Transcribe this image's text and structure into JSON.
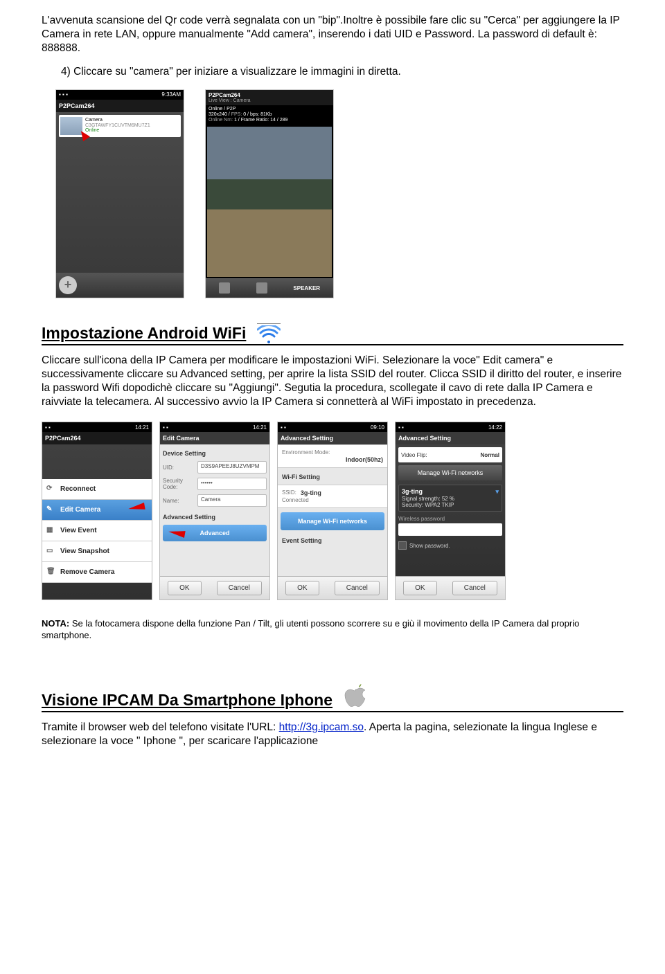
{
  "para1": "L'avvenuta scansione del Qr code verrà segnalata con un \"bip\".Inoltre è possibile fare clic su \"Cerca\" per aggiungere la IP Camera in rete LAN, oppure manualmente \"Add camera\", inserendo i dati UID e Password. La password di default è: 888888.",
  "step4": "4)  Cliccare su \"camera\" per iniziare a visualizzare le immagini in diretta.",
  "shot1": {
    "status_time": "9:33AM",
    "appname": "P2PCam264",
    "cam_name": "Camera",
    "cam_uid": "C3GTAWFY1CUVTM6MU7Z1",
    "cam_status": "Online"
  },
  "shot2": {
    "appname": "P2PCam264",
    "subtitle": "Live View : Camera",
    "line1": "Online / P2P",
    "line2_a": "320x240 / ",
    "line2_b": "FPS:",
    "line2_c": "0 / bps:",
    "line2_d": "81Kb",
    "line3_a": "Online Nm:",
    "line3_b": "1 / Frame Ratio:",
    "line3_c": "14 / 289",
    "speaker": "SPEAKER"
  },
  "heading_wifi": "Impostazione Android WiFi",
  "para_wifi": "Cliccare sull'icona della IP Camera per modificare le impostazioni WiFi. Selezionare la voce\" Edit camera\" e successivamente cliccare su Advanced setting, per aprire la lista SSID del router. Clicca SSID il diritto del router, e inserire la password Wifi dopodichè cliccare su \"Aggiungi\". Segutia la procedura, scollegate il cavo di rete dalla IP Camera e raivviate la telecamera. Al successivo avvio la IP Camera si connetterà al WiFi impostato in precedenza.",
  "shotA": {
    "time": "14:21",
    "appname": "P2PCam264",
    "items": [
      "Reconnect",
      "Edit Camera",
      "View Event",
      "View Snapshot",
      "Remove Camera"
    ]
  },
  "shotB": {
    "time": "14:21",
    "title": "Edit Camera",
    "section": "Device Setting",
    "uid_label": "UID:",
    "uid_val": "D3S9APEEJ8UZVMPM",
    "sec_label": "Security Code:",
    "sec_val": "••••••",
    "name_label": "Name:",
    "name_val": "Camera",
    "adv_label": "Advanced Setting",
    "adv_btn": "Advanced",
    "ok": "OK",
    "cancel": "Cancel"
  },
  "shotC": {
    "time": "09:10",
    "title": "Advanced Setting",
    "env_label": "Environment Mode:",
    "env_val": "Indoor(50hz)",
    "wifi_hdr": "Wi-Fi Setting",
    "ssid_label": "SSID:",
    "ssid_val": "3g-ting",
    "ssid_status": "Connected",
    "manage": "Manage Wi-Fi networks",
    "event_hdr": "Event Setting",
    "ok": "OK",
    "cancel": "Cancel"
  },
  "shotD": {
    "time": "14:22",
    "title": "Advanced Setting",
    "flip_label": "Video Flip:",
    "flip_val": "Normal",
    "manage": "Manage Wi-Fi networks",
    "net_name": "3g-ting",
    "sig": "Signal strength: 52 %",
    "sec": "Security: WPA2 TKIP",
    "pw_label": "Wireless password",
    "show_pw": "Show password.",
    "ok": "OK",
    "cancel": "Cancel"
  },
  "note_label": "NOTA:",
  "note_text": " Se la fotocamera dispone della funzione Pan / Tilt, gli utenti possono scorrere su e giù il movimento della IP Camera dal proprio smartphone.",
  "heading_iphone": "Visione IPCAM Da Smartphone Iphone",
  "para_iphone_a": "Tramite il browser web del telefono visitate l'URL: ",
  "link_url": "http://3g.ipcam.so",
  "para_iphone_b": ". Aperta la pagina, selezionate la lingua Inglese e selezionare la voce \" Iphone \", per scaricare l'applicazione"
}
